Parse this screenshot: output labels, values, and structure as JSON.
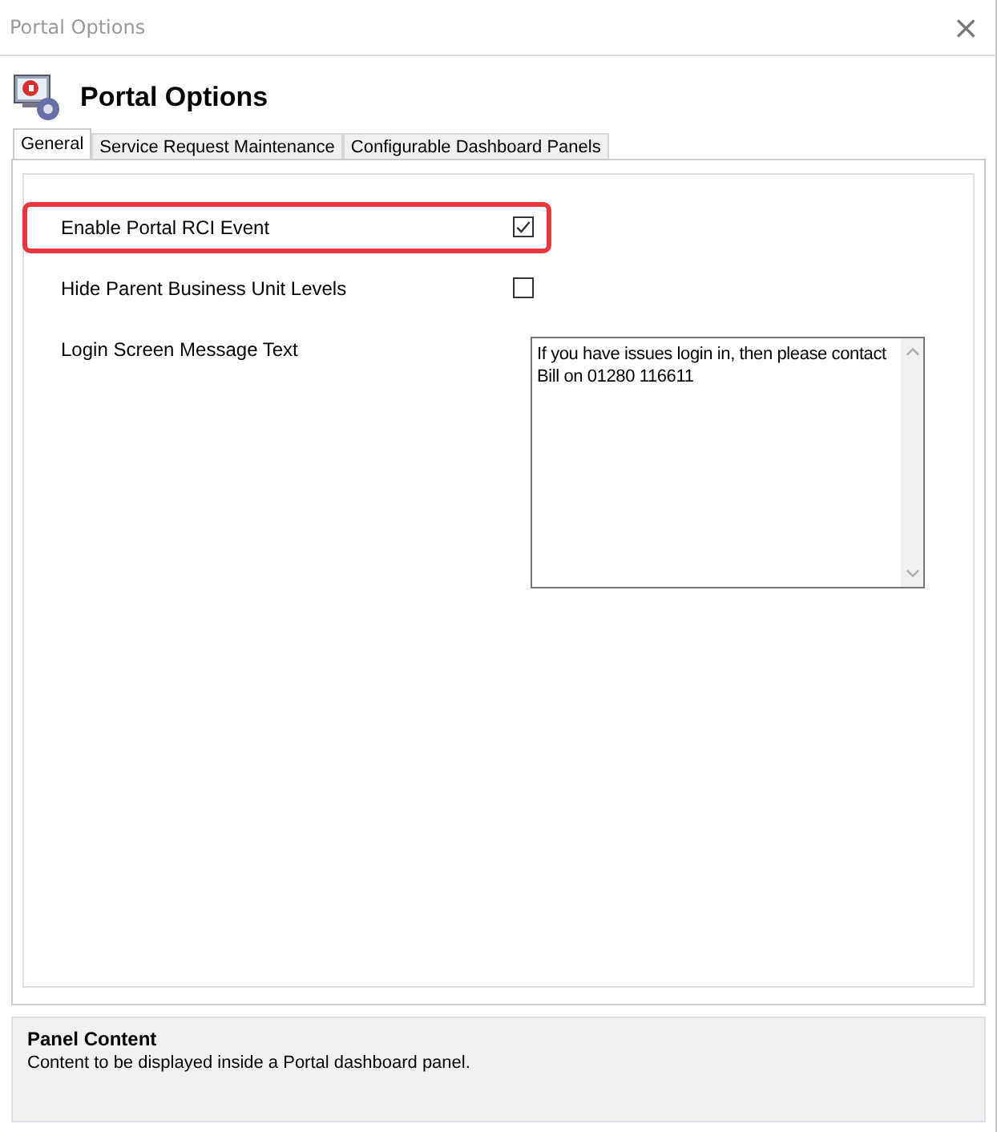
{
  "window": {
    "title": "Portal Options",
    "close": "×"
  },
  "header": {
    "title": "Portal Options"
  },
  "tabs": [
    {
      "label": "General",
      "selected": true
    },
    {
      "label": "Service Request Maintenance",
      "selected": false
    },
    {
      "label": "Configurable Dashboard Panels",
      "selected": false
    }
  ],
  "fields": [
    {
      "kind": "checkbox",
      "label": "Enable Portal RCI Event",
      "checked": true,
      "highlighted": true
    },
    {
      "kind": "checkbox",
      "label": "Hide Parent Business Unit Levels",
      "checked": false,
      "highlighted": false
    },
    {
      "kind": "textarea",
      "label": "Login Screen Message Text",
      "value": "If you have issues login in, then please contact Bill on 01280 116611",
      "highlighted": false
    }
  ],
  "help_panel": {
    "title": "Panel Content",
    "description": "Content to be displayed inside a Portal dashboard panel."
  }
}
